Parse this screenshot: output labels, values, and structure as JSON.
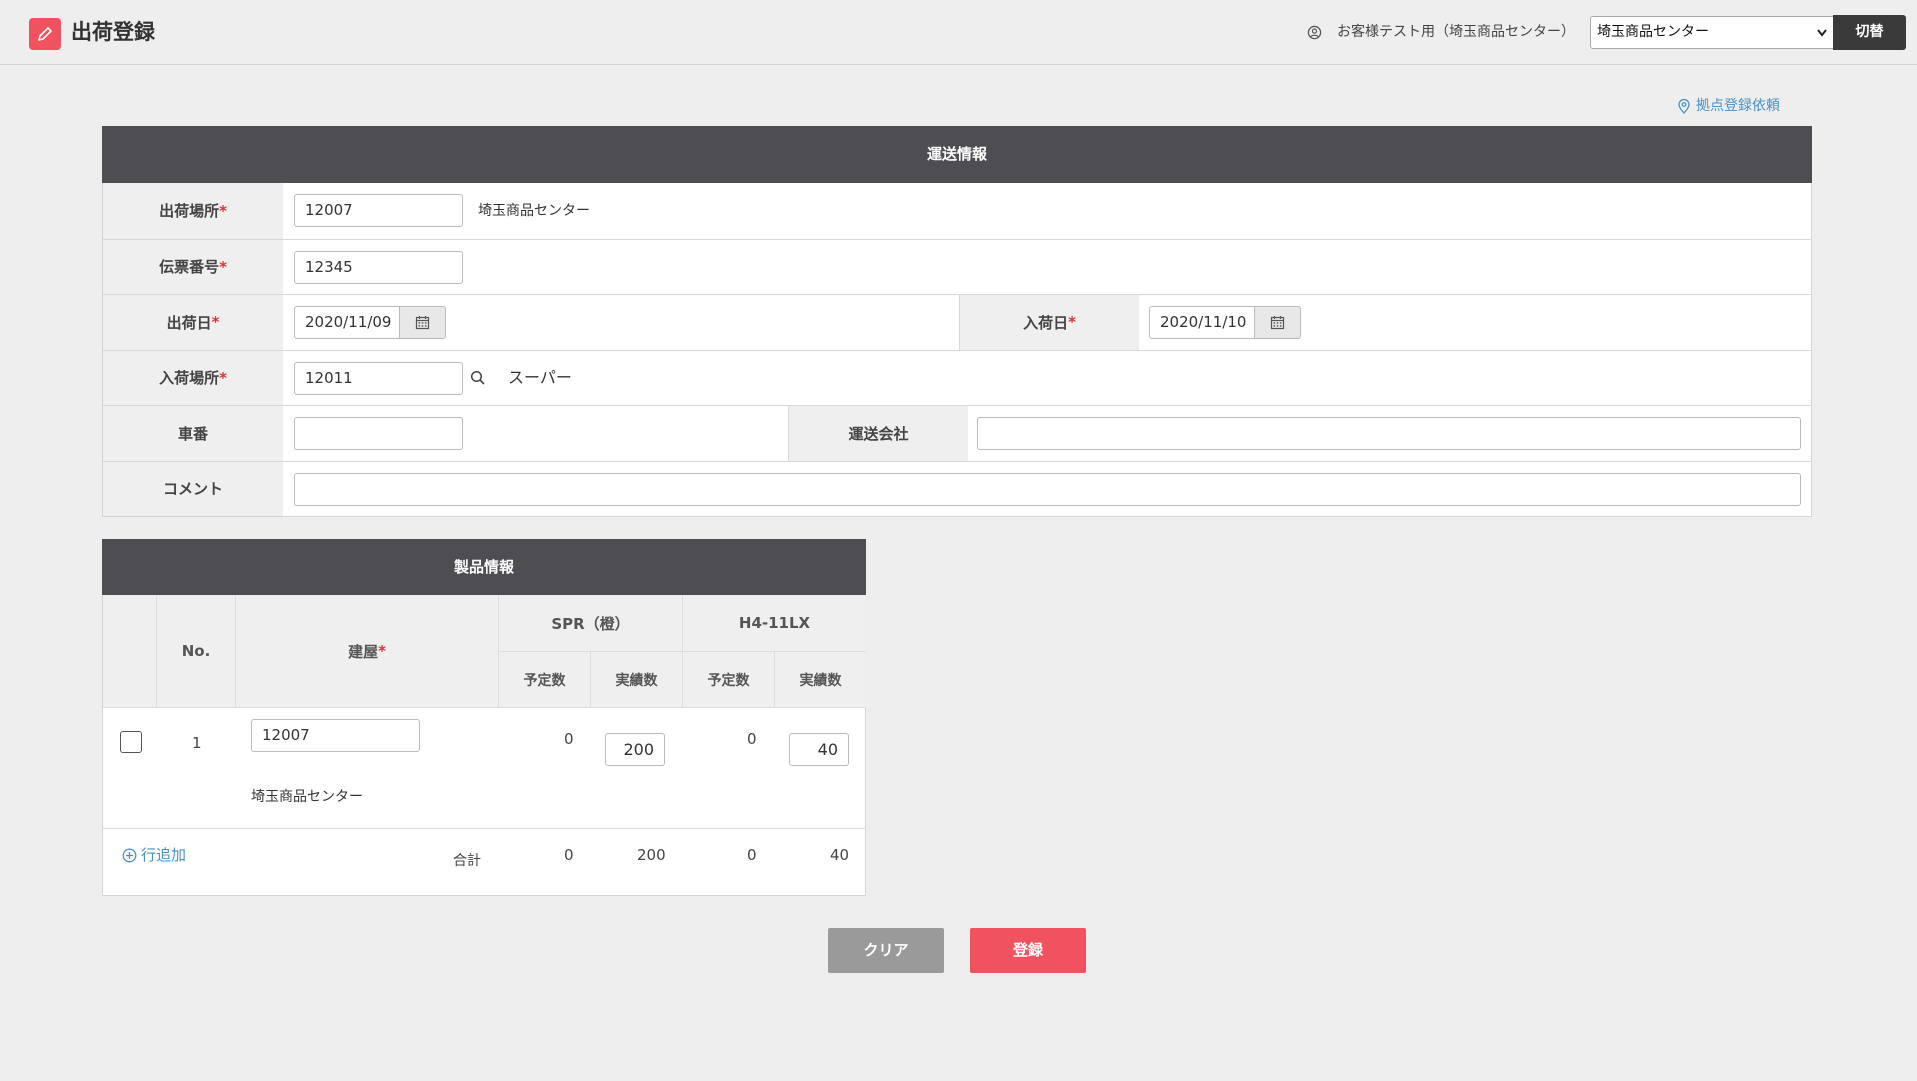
{
  "header": {
    "title": "出荷登録",
    "user_label": "お客様テスト用（埼玉商品センター）",
    "site_select_value": "埼玉商品センター",
    "switch_label": "切替"
  },
  "request_link": "拠点登録依頼",
  "shipping": {
    "section_title": "運送情報",
    "required_mark": "*",
    "ship_location": {
      "label": "出荷場所",
      "value": "12007",
      "name": "埼玉商品センター"
    },
    "slip_number": {
      "label": "伝票番号",
      "value": "12345"
    },
    "ship_date": {
      "label": "出荷日",
      "value": "2020/11/09"
    },
    "arrival_date": {
      "label": "入荷日",
      "value": "2020/11/10"
    },
    "arrival_location": {
      "label": "入荷場所",
      "value": "12011",
      "name": "スーパー"
    },
    "vehicle_number": {
      "label": "車番",
      "value": ""
    },
    "carrier": {
      "label": "運送会社",
      "value": ""
    },
    "comment": {
      "label": "コメント",
      "value": ""
    }
  },
  "product": {
    "section_title": "製品情報",
    "col_no": "No.",
    "col_building": "建屋",
    "products": [
      "SPR（橙）",
      "H4-11LX"
    ],
    "sub_planned": "予定数",
    "sub_actual": "実績数",
    "rows": [
      {
        "no": "1",
        "code": "12007",
        "name": "埼玉商品センター",
        "spr_planned": "0",
        "spr_actual": "200",
        "h4_planned": "0",
        "h4_actual": "40"
      }
    ],
    "add_row_label": "行追加",
    "total_label": "合計",
    "totals": {
      "spr_planned": "0",
      "spr_actual": "200",
      "h4_planned": "0",
      "h4_actual": "40"
    }
  },
  "buttons": {
    "clear": "クリア",
    "register": "登録"
  }
}
